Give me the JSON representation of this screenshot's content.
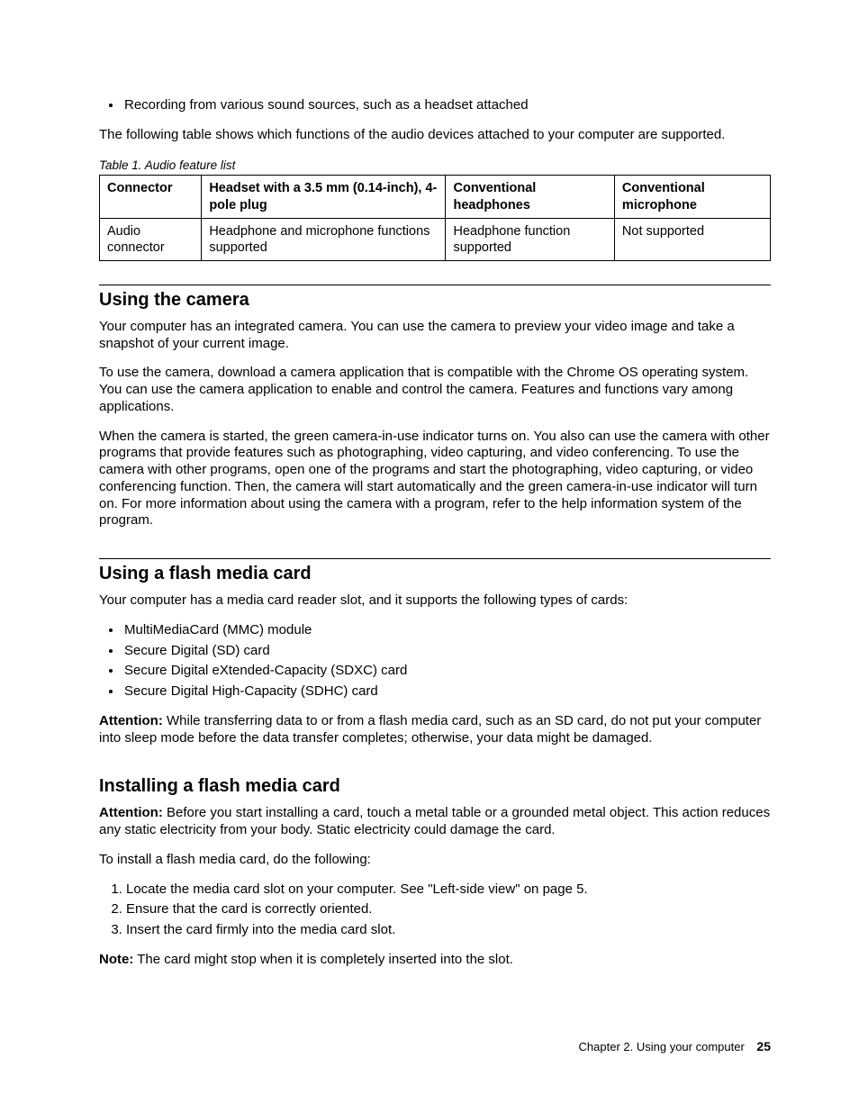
{
  "intro_bullet": "Recording from various sound sources, such as a headset attached",
  "intro_after": "The following table shows which functions of the audio devices attached to your computer are supported.",
  "table_caption": "Table 1.  Audio feature list",
  "table": {
    "headers": [
      "Connector",
      "Headset with a 3.5 mm (0.14-inch), 4-pole plug",
      "Conventional headphones",
      "Conventional microphone"
    ],
    "row": [
      "Audio connector",
      "Headphone and microphone functions supported",
      "Headphone function supported",
      "Not supported"
    ]
  },
  "section_camera": {
    "heading": "Using the camera",
    "p1": "Your computer has an integrated camera. You can use the camera to preview your video image and take a snapshot of your current image.",
    "p2": "To use the camera, download a camera application that is compatible with the Chrome OS operating system. You can use the camera application to enable and control the camera. Features and functions vary among applications.",
    "p3": "When the camera is started, the green camera-in-use indicator turns on. You also can use the camera with other programs that provide features such as photographing, video capturing, and video conferencing. To use the camera with other programs, open one of the programs and start the photographing, video capturing, or video conferencing function. Then, the camera will start automatically and the green camera-in-use indicator will turn on. For more information about using the camera with a program, refer to the help information system of the program."
  },
  "section_flash": {
    "heading": "Using a flash media card",
    "intro": "Your computer has a media card reader slot, and it supports the following types of cards:",
    "cards": [
      "MultiMediaCard (MMC) module",
      "Secure Digital (SD) card",
      "Secure Digital eXtended-Capacity (SDXC) card",
      "Secure Digital High-Capacity (SDHC) card"
    ],
    "attention_label": "Attention:",
    "attention_text": " While transferring data to or from a flash media card, such as an SD card, do not put your computer into sleep mode before the data transfer completes; otherwise, your data might be damaged."
  },
  "section_install": {
    "heading": "Installing a flash media card",
    "attention_label": "Attention:",
    "attention_text": " Before you start installing a card, touch a metal table or a grounded metal object. This action reduces any static electricity from your body. Static electricity could damage the card.",
    "lead": "To install a flash media card, do the following:",
    "steps": [
      "Locate the media card slot on your computer. See \"Left-side view\" on page 5.",
      "Ensure that the card is correctly oriented.",
      "Insert the card firmly into the media card slot."
    ],
    "note_label": "Note:",
    "note_text": " The card might stop when it is completely inserted into the slot."
  },
  "footer": {
    "chapter": "Chapter 2.  Using your computer",
    "page": "25"
  }
}
